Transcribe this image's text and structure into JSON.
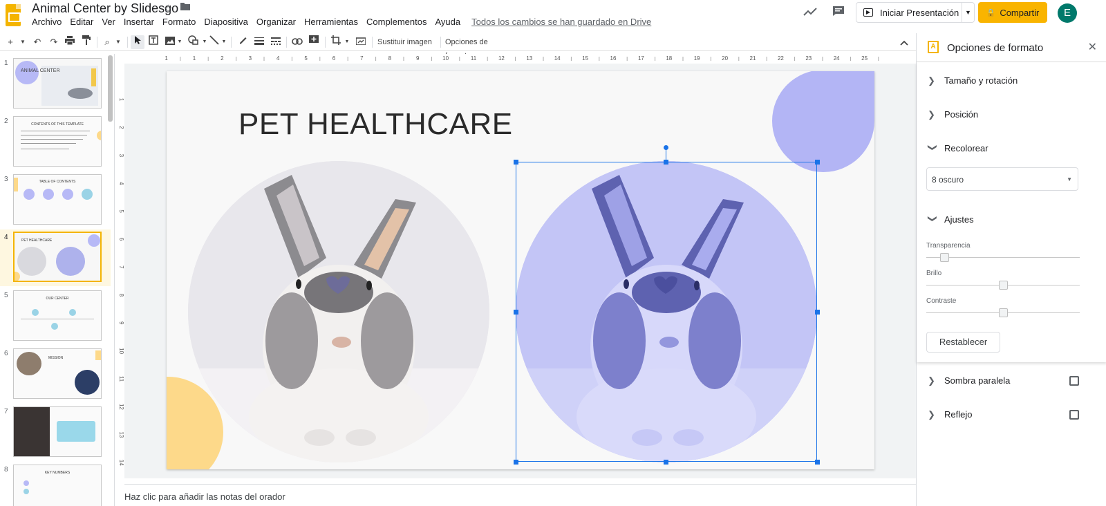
{
  "header": {
    "doc_title": "Animal Center by Slidesgo",
    "menus": [
      "Archivo",
      "Editar",
      "Ver",
      "Insertar",
      "Formato",
      "Diapositiva",
      "Organizar",
      "Herramientas",
      "Complementos",
      "Ayuda"
    ],
    "saved_status": "Todos los cambios se han guardado en Drive",
    "present_label": "Iniciar Presentación",
    "share_label": "Compartir",
    "avatar_initial": "E"
  },
  "toolbar": {
    "replace_image": "Sustituir imagen",
    "format_options": "Opciones de formato"
  },
  "filmstrip": {
    "slides": [
      {
        "num": "1",
        "title": "ANIMAL CENTER"
      },
      {
        "num": "2",
        "title": "CONTENTS OF THIS TEMPLATE"
      },
      {
        "num": "3",
        "title": "TABLE OF CONTENTS"
      },
      {
        "num": "4",
        "title": "PET HEALTHCARE"
      },
      {
        "num": "5",
        "title": "OUR CENTER"
      },
      {
        "num": "6",
        "title": "MISSION"
      },
      {
        "num": "7",
        "title": ""
      },
      {
        "num": "8",
        "title": "KEY NUMBERS"
      }
    ]
  },
  "slide": {
    "title": "PET HEALTHCARE"
  },
  "ruler": {
    "h_ticks": [
      "1",
      "1",
      "2",
      "3",
      "4",
      "5",
      "6",
      "7",
      "8",
      "9",
      "10",
      "11",
      "12",
      "13",
      "14",
      "15",
      "16",
      "17",
      "18",
      "19",
      "20",
      "21",
      "22",
      "23",
      "24",
      "25"
    ],
    "v_ticks": [
      "1",
      "2",
      "3",
      "4",
      "5",
      "6",
      "7",
      "8",
      "9",
      "10",
      "11",
      "12",
      "13",
      "14"
    ]
  },
  "notes": {
    "placeholder": "Haz clic para añadir las notas del orador"
  },
  "panel": {
    "title": "Opciones de formato",
    "size_rotation": "Tamaño y rotación",
    "position": "Posición",
    "recolor": "Recolorear",
    "recolor_value": "8 oscuro",
    "adjustments": "Ajustes",
    "transparency": "Transparencia",
    "brightness": "Brillo",
    "contrast": "Contraste",
    "reset": "Restablecer",
    "drop_shadow": "Sombra paralela",
    "reflection": "Reflejo"
  },
  "colors": {
    "accent_yellow": "#f4b400",
    "lavender": "#a9acf5",
    "peach": "#fdd98a",
    "selection_blue": "#1a73e8"
  },
  "sliders": {
    "transparency": 0.0,
    "brightness": 0.5,
    "contrast": 0.5
  }
}
